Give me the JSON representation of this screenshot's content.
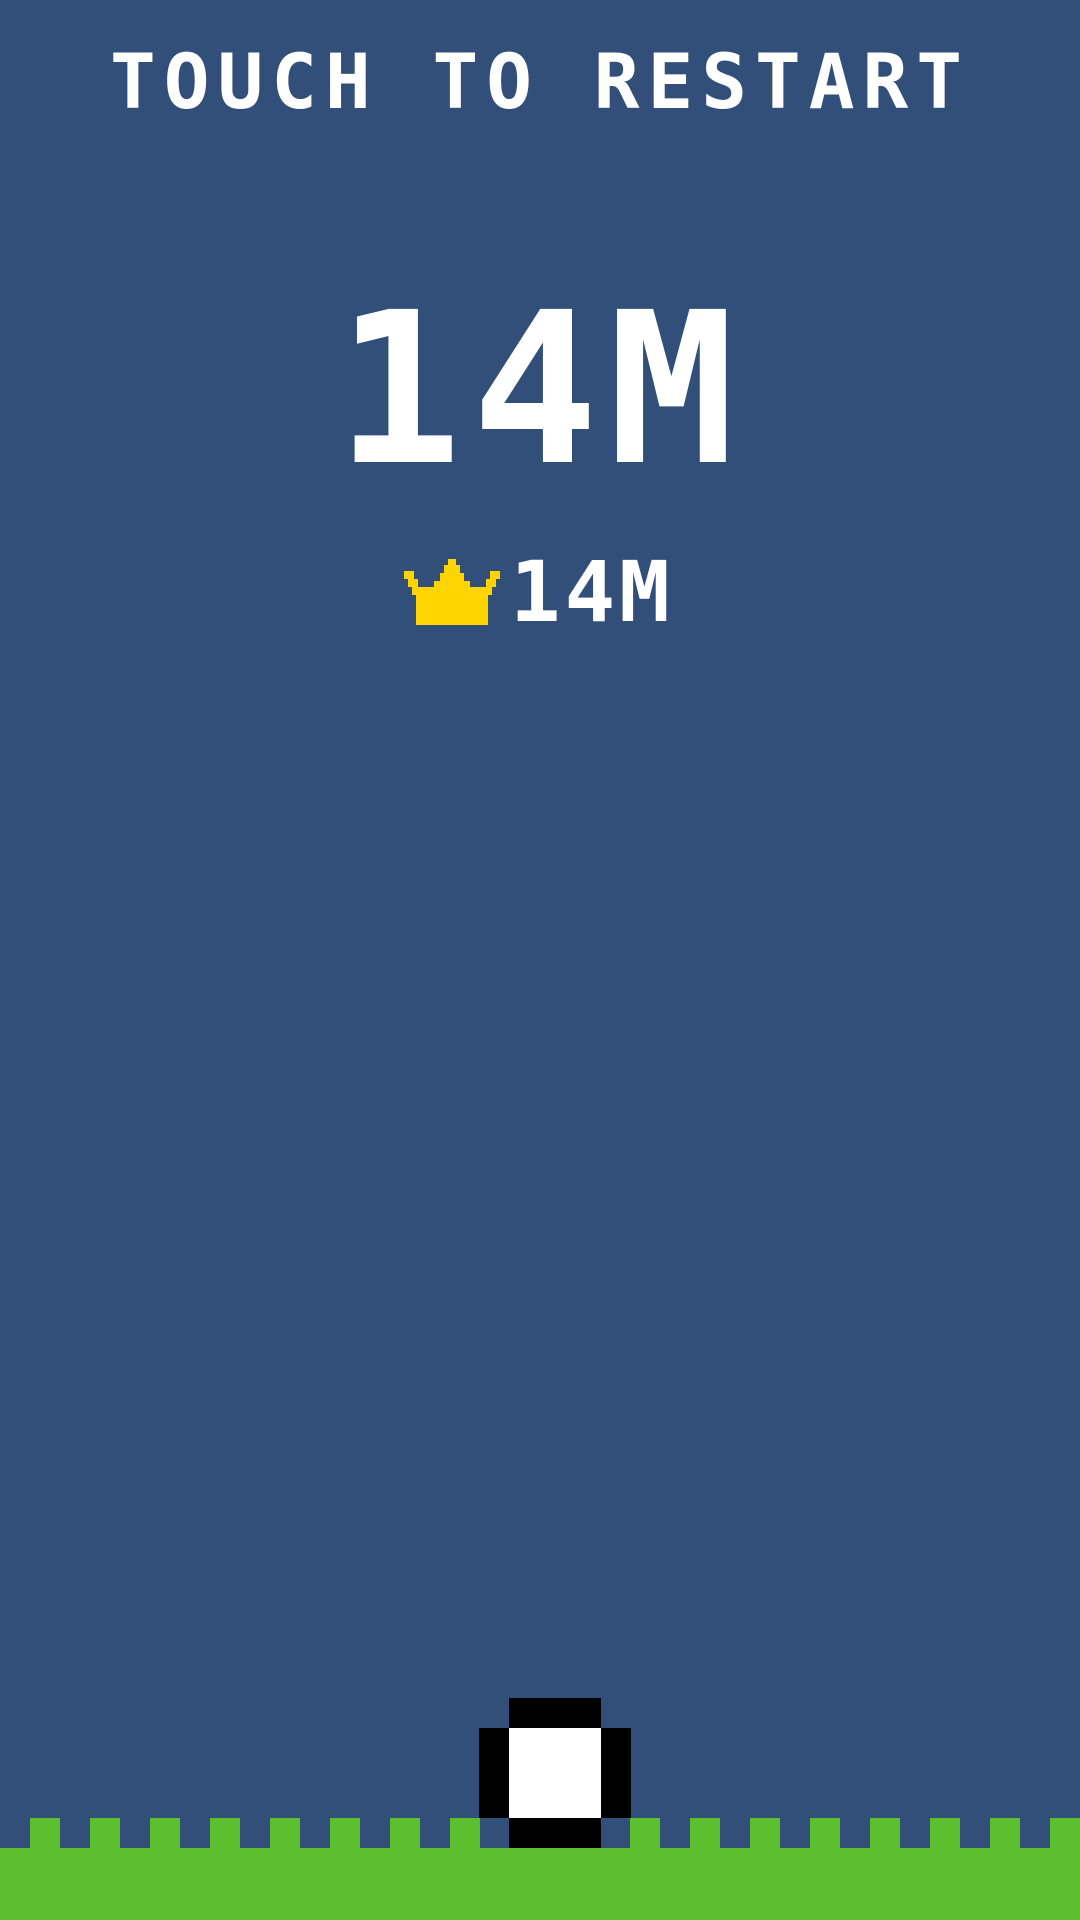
{
  "hud": {
    "restart_prompt": "TOUCH TO RESTART",
    "score": "14M",
    "best_score": "14M"
  },
  "icons": {
    "best": "crown-icon",
    "player": "ball-icon"
  },
  "colors": {
    "sky": "#324f7a",
    "grass": "#5bbf2e",
    "crown": "#ffd400",
    "text": "#ffffff",
    "ball_fill": "#ffffff",
    "ball_outline": "#000000"
  }
}
